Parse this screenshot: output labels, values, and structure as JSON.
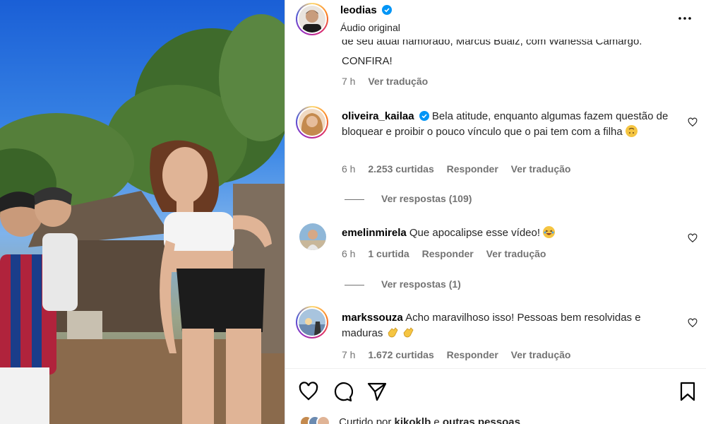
{
  "post": {
    "username": "leodias",
    "subtitle": "Áudio original",
    "caption_line1": "de seu atual namorado, Marcus Buaiz, com Wanessa Camargo.",
    "caption_line2": "CONFIRA!",
    "caption_time": "7 h",
    "caption_translate": "Ver tradução"
  },
  "comments": [
    {
      "username": "oliveira_kailaa",
      "verified": true,
      "text": "Bela atitude, enquanto algumas fazem questão de bloquear e proibir o pouco vínculo que o pai tem com a filha",
      "emoji": "upside-down-face",
      "time": "6 h",
      "likes": "2.253 curtidas",
      "reply": "Responder",
      "translate": "Ver tradução",
      "replies_label": "Ver respostas (109)"
    },
    {
      "username": "emelinmirela",
      "verified": false,
      "text": "Que apocalipse esse vídeo!",
      "emoji": "laughing-face",
      "time": "6 h",
      "likes": "1 curtida",
      "reply": "Responder",
      "translate": "Ver tradução",
      "replies_label": "Ver respostas (1)"
    },
    {
      "username": "markssouza",
      "verified": false,
      "text": "Acho maravilhoso isso! Pessoas bem resolvidas e maduras",
      "emoji": "clapping-hands",
      "time": "7 h",
      "likes": "1.672 curtidas",
      "reply": "Responder",
      "translate": "Ver tradução"
    }
  ],
  "footer": {
    "liked_prefix": "Curtido por",
    "liked_user": "kikoklb",
    "liked_suffix": "e",
    "liked_others": "outras pessoas"
  },
  "colors": {
    "verified": "#0095f6",
    "muted": "#737373",
    "text": "#262626"
  }
}
